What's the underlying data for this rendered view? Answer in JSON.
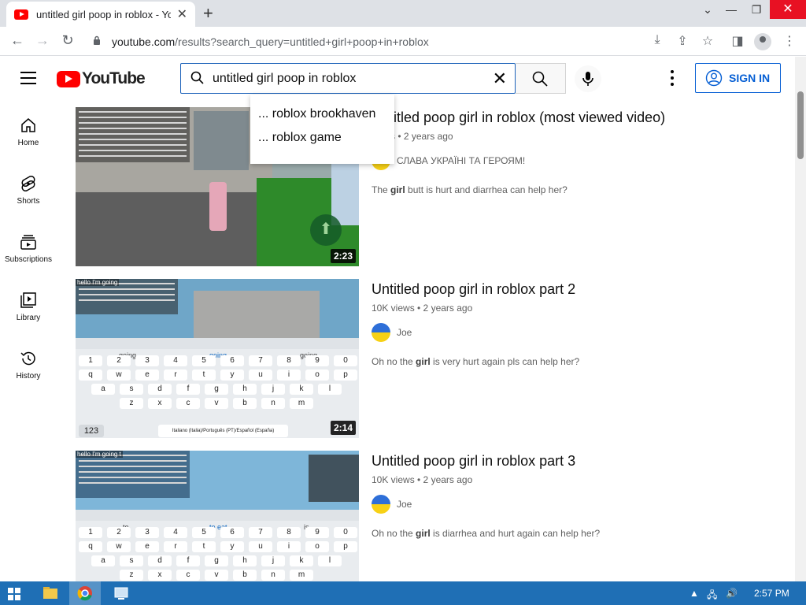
{
  "browser": {
    "tab_title": "untitled girl poop in roblox - YouTube",
    "url_host": "youtube.com",
    "url_path": "/results?search_query=untitled+girl+poop+in+roblox"
  },
  "header": {
    "logo_text": "YouTube",
    "search_value": "untitled girl poop in roblox",
    "sign_in_label": "SIGN IN",
    "suggestions": [
      "... roblox brookhaven",
      "... roblox game"
    ]
  },
  "guide": {
    "items": [
      {
        "label": "Home",
        "icon": "home-icon"
      },
      {
        "label": "Shorts",
        "icon": "shorts-icon"
      },
      {
        "label": "Subscriptions",
        "icon": "subscriptions-icon"
      },
      {
        "label": "Library",
        "icon": "library-icon"
      },
      {
        "label": "History",
        "icon": "history-icon"
      }
    ]
  },
  "results": [
    {
      "title": "Untitled poop girl in roblox (most viewed video)",
      "stats": "views • 2 years ago",
      "channel": "СЛАВА УКРАЇНІ ТА ГЕРОЯМ!",
      "desc_pre": "The ",
      "desc_bold": "girl",
      "desc_post": " butt is hurt and diarrhea can help her?",
      "duration": "2:23"
    },
    {
      "title": "Untitled poop girl in roblox part 2",
      "stats": "10K views • 2 years ago",
      "channel": "Joe",
      "desc_pre": "Oh no the ",
      "desc_bold": "girl",
      "desc_post": " is very hurt again pls can help her?",
      "duration": "2:14",
      "overlay": "hello I'm going"
    },
    {
      "title": "Untitled poop girl in roblox part 3",
      "stats": "10K views • 2 years ago",
      "channel": "Joe",
      "desc_pre": "Oh no the ",
      "desc_bold": "girl",
      "desc_post": " is diarrhea and hurt again can help her?",
      "overlay": "hello I'm going t"
    }
  ],
  "keyboard": {
    "row_numbers": [
      "1",
      "2",
      "3",
      "4",
      "5",
      "6",
      "7",
      "8",
      "9",
      "0"
    ],
    "row_q": [
      "q",
      "w",
      "e",
      "r",
      "t",
      "y",
      "u",
      "i",
      "o",
      "p"
    ],
    "row_a": [
      "a",
      "s",
      "d",
      "f",
      "g",
      "h",
      "j",
      "k",
      "l"
    ],
    "row_z": [
      "z",
      "x",
      "c",
      "v",
      "b",
      "n",
      "m"
    ],
    "mode_key": "123",
    "lang_label": "Italiano (Italia)/Português (PT)/Español (España)",
    "suggest_2": [
      "going",
      "going",
      "going"
    ],
    "suggest_3": [
      "to",
      "to eat",
      "is"
    ]
  },
  "taskbar": {
    "time": "2:57 PM"
  },
  "colors": {
    "youtube_red": "#ff0000",
    "link_blue": "#065fd4",
    "taskbar_blue": "#1f6fb5"
  }
}
